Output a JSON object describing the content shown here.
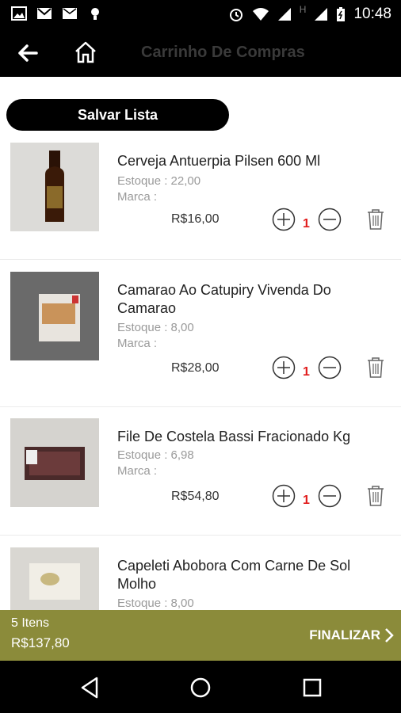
{
  "status_bar": {
    "time": "10:48",
    "left_icons": [
      "image-icon",
      "gmail-icon",
      "mail-icon",
      "bulb-icon"
    ],
    "right_icons": [
      "alarm-icon",
      "wifi-icon",
      "signal-icon",
      "h-icon",
      "signal-icon",
      "battery-icon"
    ],
    "network_letter": "H"
  },
  "app_bar": {
    "title": "Carrinho De Compras",
    "back_icon": "arrow-left-icon",
    "home_icon": "home-icon"
  },
  "save_button": {
    "label": "Salvar Lista"
  },
  "items": [
    {
      "name": "Cerveja Antuerpia Pilsen 600 Ml",
      "stock": "Estoque : 22,00",
      "brand": "Marca :",
      "price": "R$16,00",
      "qty": "1"
    },
    {
      "name": "Camarao Ao Catupiry Vivenda Do Camarao",
      "stock": "Estoque : 8,00",
      "brand": "Marca :",
      "price": "R$28,00",
      "qty": "1"
    },
    {
      "name": "File De Costela Bassi Fracionado Kg",
      "stock": "Estoque : 6,98",
      "brand": "Marca :",
      "price": "R$54,80",
      "qty": "1"
    },
    {
      "name": "Capeleti Abobora Com Carne De Sol Molho",
      "stock": "Estoque : 8,00",
      "brand": "",
      "price": "",
      "qty": ""
    }
  ],
  "footer": {
    "count": "5 Itens",
    "total": "R$137,80",
    "finalize_label": "FINALIZAR",
    "accent_color": "#8b8b3a"
  },
  "nav_bar": {
    "icons": [
      "back-triangle-icon",
      "home-circle-icon",
      "recents-square-icon"
    ]
  }
}
